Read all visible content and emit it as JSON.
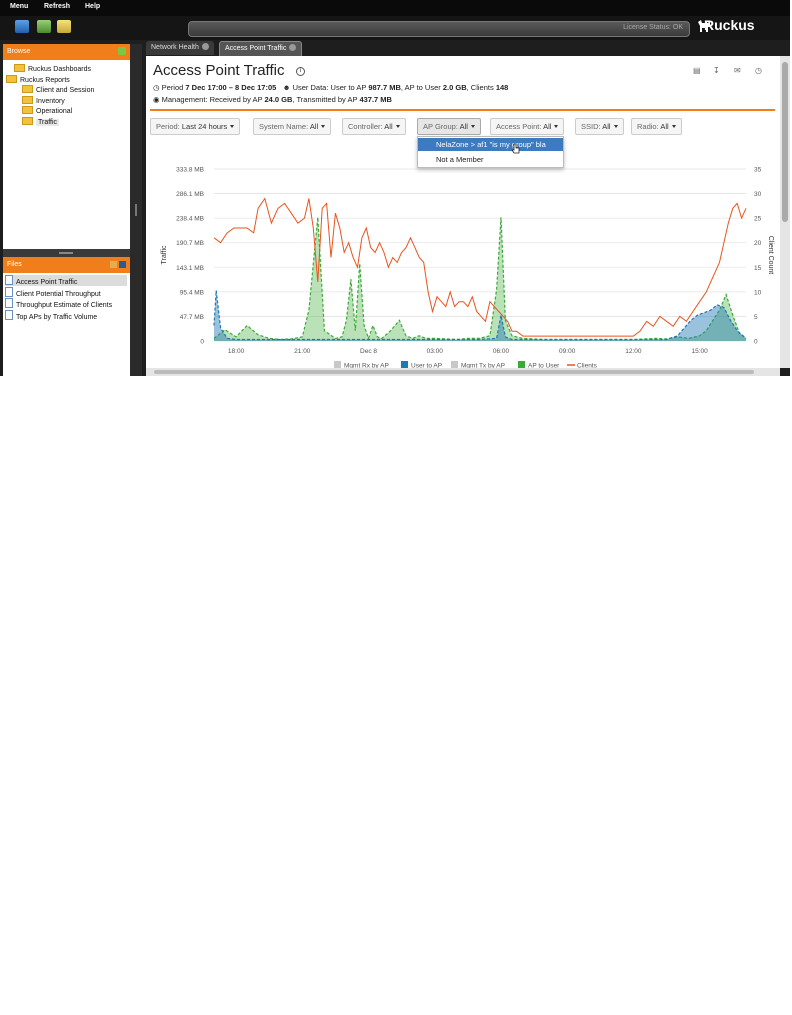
{
  "menu": {
    "items": [
      "Menu",
      "Refresh",
      "Help"
    ]
  },
  "header": {
    "license_status": "License Status: OK",
    "logo_text": "Ruckus"
  },
  "browse_panel": {
    "title": "Browse",
    "tree": [
      {
        "label": "Ruckus Dashboards",
        "level": 1
      },
      {
        "label": "Ruckus Reports",
        "level": 0
      },
      {
        "label": "Client and Session",
        "level": 2
      },
      {
        "label": "Inventory",
        "level": 2
      },
      {
        "label": "Operational",
        "level": 2
      },
      {
        "label": "Traffic",
        "level": 2,
        "selected": true
      }
    ]
  },
  "files_panel": {
    "title": "Files",
    "items": [
      "Access Point Traffic",
      "Client Potential Throughput",
      "Throughput Estimate of Clients",
      "Top APs by Traffic Volume"
    ],
    "selected_index": 0
  },
  "tabs": [
    {
      "label": "Network Health",
      "active": false
    },
    {
      "label": "Access Point Traffic",
      "active": true
    }
  ],
  "report": {
    "title": "Access Point Traffic",
    "period_label": "Period",
    "period_value": "7 Dec 17:00 – 8 Dec 17:05",
    "user_data_label": "User Data: User to AP",
    "user_to_ap": "987.7 MB",
    "ap_to_user_label": ", AP to User",
    "ap_to_user": "2.0 GB",
    "clients_label": ", Clients",
    "clients": "148",
    "management_label": "Management: Received by AP",
    "received": "24.0 GB",
    "transmitted_label": ", Transmitted by AP",
    "transmitted": "437.7 MB"
  },
  "filters": [
    {
      "label": "Period:",
      "value": "Last 24 hours"
    },
    {
      "label": "System Name:",
      "value": "All"
    },
    {
      "label": "Controller:",
      "value": "All"
    },
    {
      "label": "AP Group:",
      "value": "All"
    },
    {
      "label": "Access Point:",
      "value": "All"
    },
    {
      "label": "SSID:",
      "value": "All"
    },
    {
      "label": "Radio:",
      "value": "All"
    }
  ],
  "ap_group_dropdown": {
    "options": [
      "NelaZone > af1 \"is my group\" bla",
      "Not a Member"
    ],
    "highlighted_index": 0
  },
  "colors": {
    "accent": "#f07f1b",
    "user_to_ap": "#1f77b4",
    "ap_to_user": "#3aaa35",
    "clients": "#e8541e",
    "mgmt": "#c8c8c8"
  },
  "chart_data": {
    "type": "area",
    "ylabel": "Traffic",
    "y2label": "Client Count",
    "y_ticks": [
      "333.8 MB",
      "286.1 MB",
      "238.4 MB",
      "190.7 MB",
      "143.1 MB",
      "95.4 MB",
      "47.7 MB",
      "0"
    ],
    "y2_ticks": [
      "35",
      "30",
      "25",
      "20",
      "15",
      "10",
      "5",
      "0"
    ],
    "ylim_mb": [
      0,
      333.8
    ],
    "y2lim": [
      0,
      35
    ],
    "x_ticks": [
      "18:00",
      "21:00",
      "Dec 8",
      "03:00",
      "06:00",
      "09:00",
      "12:00",
      "15:00"
    ],
    "x_hours": [
      17.0,
      41.1
    ],
    "x_tick_hours": [
      18,
      21,
      24,
      27,
      30,
      33,
      36,
      39
    ],
    "legend": [
      "Mgmt Rx by AP",
      "User to AP",
      "Mgmt Tx by AP",
      "AP to User",
      "Clients"
    ],
    "series": [
      {
        "name": "Clients",
        "axis": "right",
        "x": [
          17.0,
          17.3,
          17.6,
          17.9,
          18.2,
          18.5,
          18.8,
          19.0,
          19.3,
          19.6,
          19.9,
          20.2,
          20.5,
          20.8,
          21.1,
          21.3,
          21.5,
          21.7,
          21.9,
          22.1,
          22.3,
          22.5,
          22.7,
          22.9,
          23.1,
          23.3,
          23.5,
          23.7,
          23.9,
          24.1,
          24.3,
          24.5,
          24.7,
          24.9,
          25.1,
          25.3,
          25.5,
          25.7,
          25.9,
          26.1,
          26.3,
          26.5,
          26.7,
          26.9,
          27.1,
          27.3,
          27.5,
          27.7,
          27.9,
          28.1,
          28.3,
          28.5,
          28.7,
          28.9,
          29.1,
          29.3,
          29.5,
          29.7,
          29.9,
          30.1,
          30.3,
          30.5,
          30.7,
          31.0,
          31.5,
          32.0,
          32.5,
          33.0,
          33.5,
          34.0,
          34.5,
          35.0,
          35.5,
          36.0,
          36.3,
          36.6,
          36.9,
          37.2,
          37.5,
          37.8,
          38.1,
          38.4,
          38.7,
          39.0,
          39.3,
          39.6,
          39.9,
          40.1,
          40.3,
          40.5,
          40.7,
          40.9,
          41.1
        ],
        "y": [
          21,
          20,
          22,
          23,
          23,
          23,
          22,
          27,
          29,
          24,
          27,
          28,
          26,
          24,
          25,
          29,
          23,
          12,
          27,
          28,
          17,
          26,
          23,
          18,
          20,
          17,
          15,
          21,
          23,
          19,
          18,
          20,
          18,
          15,
          17,
          16,
          18,
          19,
          21,
          19,
          17,
          16,
          10,
          6,
          9,
          8,
          7,
          10,
          7,
          8,
          8,
          7,
          9,
          6,
          5,
          4,
          8,
          7,
          6,
          5,
          4,
          2,
          2,
          1,
          1,
          1,
          1,
          1,
          1,
          1,
          1,
          1,
          1,
          1,
          2,
          4,
          3,
          5,
          4,
          3,
          5,
          4,
          6,
          8,
          10,
          13,
          16,
          20,
          24,
          27,
          28,
          25,
          27
        ]
      },
      {
        "name": "AP to User",
        "axis": "left",
        "x": [
          17.0,
          17.5,
          18.0,
          18.5,
          19.0,
          19.5,
          20.0,
          20.5,
          21.0,
          21.3,
          21.5,
          21.7,
          22.0,
          22.5,
          22.8,
          23.0,
          23.2,
          23.4,
          23.6,
          23.8,
          24.0,
          24.2,
          24.4,
          24.6,
          25.0,
          25.4,
          25.7,
          26.0,
          26.3,
          26.6,
          27.0,
          28.0,
          28.5,
          29.0,
          29.5,
          29.8,
          30.0,
          30.2,
          30.5,
          31.0,
          32.0,
          33.0,
          34.0,
          35.0,
          36.0,
          37.0,
          37.5,
          38.0,
          38.5,
          39.0,
          39.3,
          39.6,
          39.9,
          40.2,
          40.5,
          40.8,
          41.1
        ],
        "y": [
          5,
          22,
          8,
          30,
          12,
          5,
          3,
          4,
          8,
          60,
          150,
          240,
          20,
          5,
          8,
          40,
          120,
          20,
          150,
          30,
          5,
          30,
          8,
          5,
          20,
          40,
          10,
          5,
          10,
          5,
          5,
          3,
          5,
          5,
          10,
          100,
          240,
          40,
          10,
          5,
          3,
          3,
          3,
          3,
          3,
          5,
          4,
          8,
          5,
          10,
          20,
          40,
          60,
          90,
          50,
          15,
          5
        ]
      },
      {
        "name": "User to AP",
        "axis": "left",
        "x": [
          17.0,
          17.1,
          17.3,
          17.6,
          18.0,
          19.0,
          20.0,
          21.0,
          22.0,
          23.0,
          24.0,
          25.0,
          26.0,
          27.0,
          28.0,
          29.0,
          29.8,
          30.0,
          30.2,
          30.5,
          31.0,
          32.0,
          33.0,
          34.0,
          35.0,
          36.0,
          37.0,
          37.5,
          38.0,
          38.3,
          38.6,
          38.9,
          39.2,
          39.5,
          39.8,
          40.1,
          40.4,
          40.7,
          41.1
        ],
        "y": [
          30,
          98,
          25,
          5,
          3,
          3,
          3,
          3,
          3,
          3,
          3,
          3,
          3,
          3,
          3,
          3,
          5,
          50,
          8,
          3,
          3,
          3,
          3,
          3,
          3,
          3,
          3,
          3,
          10,
          25,
          40,
          50,
          55,
          60,
          70,
          65,
          40,
          20,
          5
        ]
      }
    ]
  }
}
